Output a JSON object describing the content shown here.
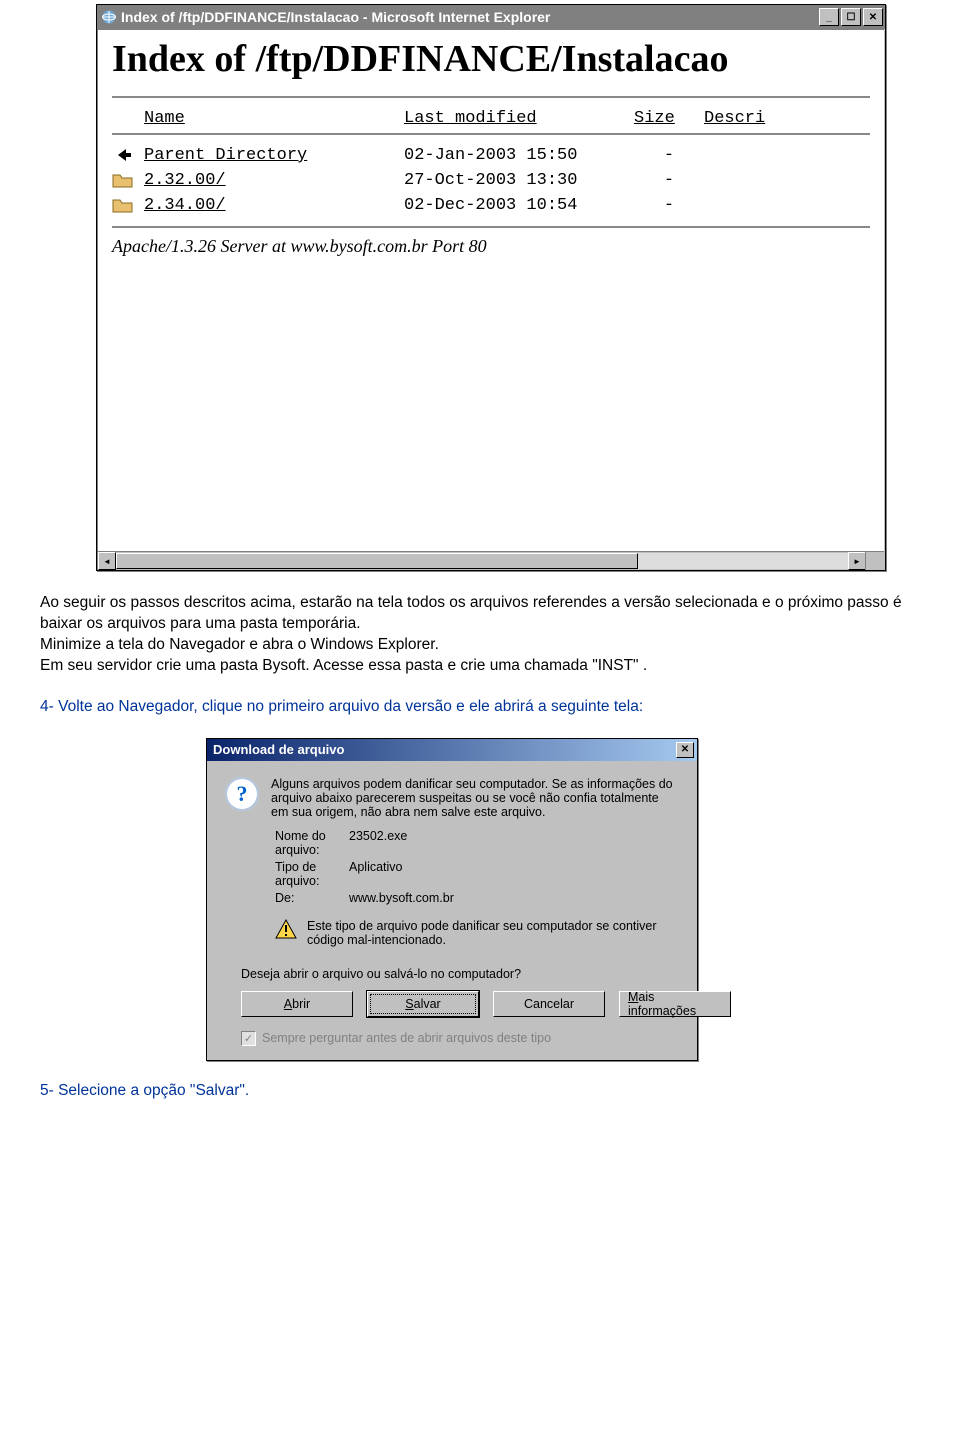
{
  "browser": {
    "title": "Index of /ftp/DDFINANCE/Instalacao - Microsoft Internet Explorer",
    "heading": "Index of /ftp/DDFINANCE/Instalacao",
    "columns": {
      "name": "Name",
      "modified": "Last modified",
      "size": "Size",
      "desc": "Descri"
    },
    "rows": [
      {
        "icon": "back",
        "name": "Parent Directory",
        "modified": "02-Jan-2003 15:50",
        "size": "-"
      },
      {
        "icon": "folder",
        "name": "2.32.00/",
        "modified": "27-Oct-2003 13:30",
        "size": "-"
      },
      {
        "icon": "folder",
        "name": "2.34.00/",
        "modified": "02-Dec-2003 10:54",
        "size": "-"
      }
    ],
    "server_sig": "Apache/1.3.26 Server at www.bysoft.com.br Port 80"
  },
  "instructions": {
    "p1": "Ao seguir os passos descritos acima, estarão na tela todos os arquivos referendes a versão selecionada e o próximo passo é baixar os arquivos para uma pasta temporária.",
    "p2": "Minimize a tela do Navegador e abra o Windows Explorer.",
    "p3": "Em seu servidor crie  uma pasta Bysoft. Acesse essa pasta e crie uma chamada \"INST\" .",
    "step4": "4- Volte ao Navegador, clique no primeiro arquivo da versão e ele abrirá a seguinte tela:",
    "step5": "5- Selecione a opção \"Salvar\"."
  },
  "dialog": {
    "title": "Download de arquivo",
    "warning_intro": "Alguns arquivos podem danificar seu computador. Se as informações do arquivo abaixo parecerem suspeitas ou se você não confia totalmente em sua origem, não abra nem salve este arquivo.",
    "meta": {
      "name_label": "Nome do arquivo:",
      "name_value": "23502.exe",
      "type_label": "Tipo de arquivo:",
      "type_value": "Aplicativo",
      "from_label": "De:",
      "from_value": "www.bysoft.com.br"
    },
    "warn2": "Este tipo de arquivo pode danificar seu computador se contiver código mal-intencionado.",
    "question": "Deseja abrir o arquivo ou salvá-lo no computador?",
    "buttons": {
      "open": "Abrir",
      "save": "Salvar",
      "cancel": "Cancelar",
      "more": "Mais informações"
    },
    "checkbox": "Sempre perguntar antes de abrir arquivos deste tipo"
  }
}
